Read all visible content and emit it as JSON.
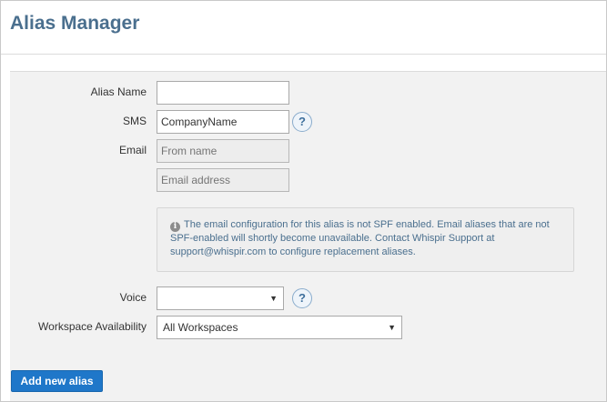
{
  "page": {
    "title": "Alias Manager"
  },
  "form": {
    "alias_name": {
      "label": "Alias Name",
      "value": "",
      "placeholder": ""
    },
    "sms": {
      "label": "SMS",
      "value": "CompanyName",
      "help": "?"
    },
    "email": {
      "label": "Email",
      "from_name_placeholder": "From name",
      "address_placeholder": "Email address"
    },
    "notice": {
      "icon": "info-icon",
      "text": "The email configuration for this alias is not SPF enabled. Email aliases that are not SPF-enabled will shortly become unavailable. Contact Whispir Support at support@whispir.com to configure replacement aliases."
    },
    "voice": {
      "label": "Voice",
      "selected": "",
      "help": "?"
    },
    "workspace": {
      "label": "Workspace Availability",
      "selected": "All Workspaces"
    },
    "submit_label": "Add new alias"
  },
  "colors": {
    "title": "#4a6f8e",
    "button": "#1f77c9",
    "panel": "#f2f2f2",
    "notice_text": "#4a6f8e"
  }
}
